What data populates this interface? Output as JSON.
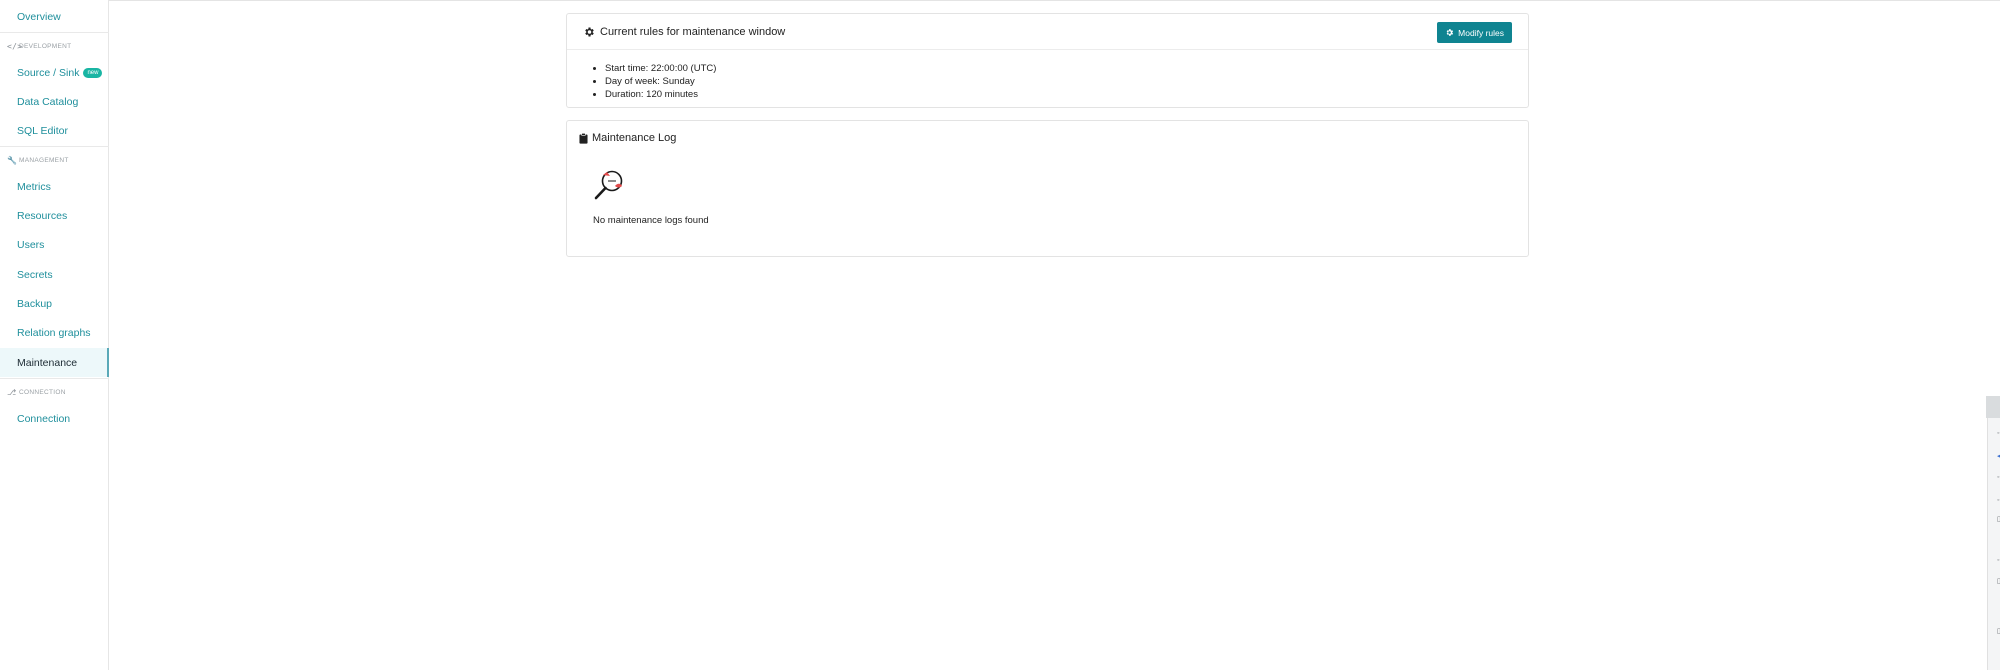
{
  "sidebar": {
    "overview": "Overview",
    "sections": {
      "development": "DEVELOPMENT",
      "management": "MANAGEMENT",
      "connection": "CONNECTION"
    },
    "development_items": [
      {
        "label": "Source / Sink",
        "badge": "new"
      },
      {
        "label": "Data Catalog"
      },
      {
        "label": "SQL Editor"
      }
    ],
    "management_items": [
      {
        "label": "Metrics"
      },
      {
        "label": "Resources"
      },
      {
        "label": "Users"
      },
      {
        "label": "Secrets"
      },
      {
        "label": "Backup"
      },
      {
        "label": "Relation graphs"
      },
      {
        "label": "Maintenance",
        "active": true
      }
    ],
    "connection_items": [
      {
        "label": "Connection"
      }
    ]
  },
  "rules_card": {
    "title": "Current rules for maintenance window",
    "modify_button": "Modify rules",
    "items": [
      "Start time: 22:00:00 (UTC)",
      "Day of week: Sunday",
      "Duration: 120 minutes"
    ]
  },
  "log_card": {
    "title": "Maintenance Log",
    "empty_text": "No maintenance logs found"
  },
  "colors": {
    "accent": "#0f8491",
    "link": "#1f8f9c",
    "badge": "#19b5a3",
    "active_bg": "#edf8fa"
  },
  "icons": {
    "development": "code-icon",
    "management": "wrench-icon",
    "connection": "branch-icon",
    "rules": "gear-icon",
    "log": "clipboard-icon",
    "empty": "magnifier-empty-icon"
  }
}
